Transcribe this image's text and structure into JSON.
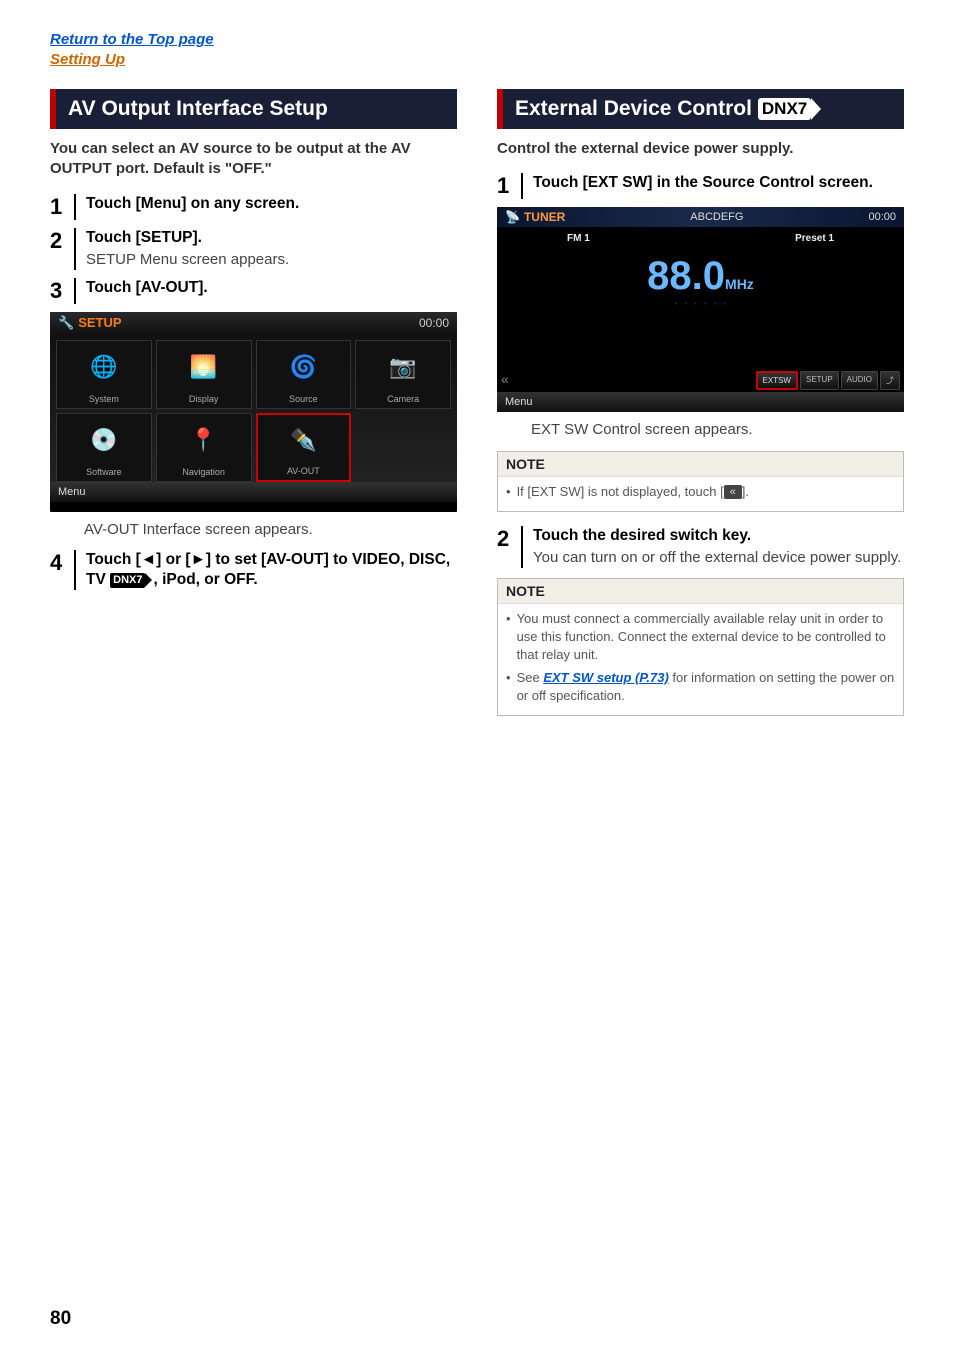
{
  "breadcrumb": {
    "top": "Return to the Top page",
    "section": "Setting Up"
  },
  "left": {
    "heading": "AV Output Interface Setup",
    "intro": "You can select an AV source to be output at the AV OUTPUT port. Default is \"OFF.\"",
    "step1": "Touch [Menu] on any screen.",
    "step2_title": "Touch [SETUP].",
    "step2_desc": "SETUP Menu screen appears.",
    "step3": "Touch [AV-OUT].",
    "shot": {
      "setup_label": "SETUP",
      "clock": "00:00",
      "tiles": [
        "System",
        "Display",
        "Source",
        "Camera",
        "Software",
        "Navigation",
        "AV-OUT"
      ],
      "menu": "Menu"
    },
    "after_shot": "AV-OUT Interface screen appears.",
    "step4_a": "Touch [◄] or [►] to set [AV-OUT] to VIDEO, DISC, TV ",
    "step4_dnx": "DNX7",
    "step4_b": ", iPod, or OFF."
  },
  "right": {
    "heading": "External Device Control",
    "heading_badge": "DNX7",
    "intro": "Control the external device power supply.",
    "step1": "Touch [EXT SW] in the Source Control screen.",
    "shot": {
      "tuner_label": "TUNER",
      "abcdefg": "ABCDEFG",
      "clock": "00:00",
      "band": "FM 1",
      "preset": "Preset 1",
      "freq": "88.0",
      "mhz": "MHz",
      "btns": {
        "extsw": "EXTSW",
        "setup": "SETUP",
        "audio": "AUDIO"
      },
      "menu": "Menu"
    },
    "after_shot": "EXT SW Control screen appears.",
    "note1": {
      "title": "NOTE",
      "text_a": "If [EXT SW] is not displayed, touch [",
      "text_b": "]."
    },
    "step2_title": "Touch the desired switch key.",
    "step2_desc": "You can turn on or off the external device power supply.",
    "note2": {
      "title": "NOTE",
      "b1": "You must connect a commercially available relay unit in order to use this function. Connect the external device to be controlled to that relay unit.",
      "b2_a": "See ",
      "b2_link": "EXT SW setup (P.73)",
      "b2_b": " for information on setting the power on or off specification."
    }
  },
  "page_num": "80"
}
